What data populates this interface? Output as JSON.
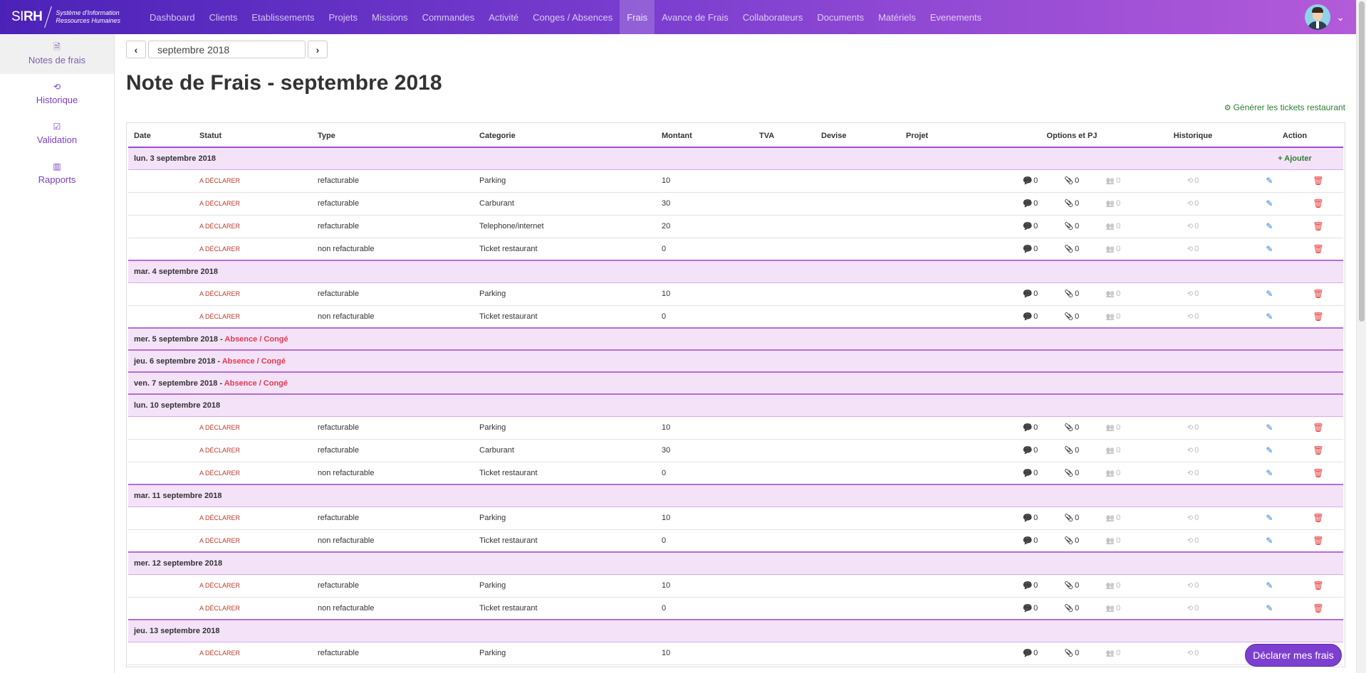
{
  "brand": {
    "mark_bold": "SI",
    "mark_rh": "RH",
    "line1": "Système d'Information",
    "line2": "Ressources Humaines"
  },
  "nav": [
    "Dashboard",
    "Clients",
    "Etablissements",
    "Projets",
    "Missions",
    "Commandes",
    "Activité",
    "Conges / Absences",
    "Frais",
    "Avance de Frais",
    "Collaborateurs",
    "Documents",
    "Matériels",
    "Evenements"
  ],
  "nav_active": "Frais",
  "sidebar": [
    {
      "label": "Notes de frais",
      "icon": "document-icon",
      "glyph": "🗎",
      "active": true
    },
    {
      "label": "Historique",
      "icon": "history-icon",
      "glyph": "⟲",
      "active": false
    },
    {
      "label": "Validation",
      "icon": "check-square-icon",
      "glyph": "☑",
      "active": false
    },
    {
      "label": "Rapports",
      "icon": "bar-chart-icon",
      "glyph": "▥",
      "active": false
    }
  ],
  "month": {
    "value": "septembre 2018",
    "prev": "‹",
    "next": "›"
  },
  "title": "Note de Frais - septembre 2018",
  "generate_label": "Générer les tickets restaurant",
  "add_label": "Ajouter",
  "columns": [
    "Date",
    "Statut",
    "Type",
    "Categorie",
    "Montant",
    "TVA",
    "Devise",
    "Projet",
    "Options et PJ",
    "Historique",
    "Action"
  ],
  "status_label": "A DÉCLARER",
  "absence_label": "Absence / Congé",
  "counts": {
    "comments": "0",
    "attachments": "0",
    "participants": "0",
    "history": "0"
  },
  "days": [
    {
      "label": "lun. 3 septembre 2018",
      "absence": false,
      "add": true,
      "entries": [
        {
          "type": "refacturable",
          "category": "Parking",
          "amount": "10"
        },
        {
          "type": "refacturable",
          "category": "Carburant",
          "amount": "30"
        },
        {
          "type": "refacturable",
          "category": "Telephone/internet",
          "amount": "20"
        },
        {
          "type": "non refacturable",
          "category": "Ticket restaurant",
          "amount": "0"
        }
      ]
    },
    {
      "label": "mar. 4 septembre 2018",
      "absence": false,
      "entries": [
        {
          "type": "refacturable",
          "category": "Parking",
          "amount": "10"
        },
        {
          "type": "non refacturable",
          "category": "Ticket restaurant",
          "amount": "0"
        }
      ]
    },
    {
      "label": "mer. 5 septembre 2018",
      "absence": true,
      "entries": []
    },
    {
      "label": "jeu. 6 septembre 2018",
      "absence": true,
      "entries": []
    },
    {
      "label": "ven. 7 septembre 2018",
      "absence": true,
      "entries": []
    },
    {
      "label": "lun. 10 septembre 2018",
      "absence": false,
      "entries": [
        {
          "type": "refacturable",
          "category": "Parking",
          "amount": "10"
        },
        {
          "type": "refacturable",
          "category": "Carburant",
          "amount": "30"
        },
        {
          "type": "non refacturable",
          "category": "Ticket restaurant",
          "amount": "0"
        }
      ]
    },
    {
      "label": "mar. 11 septembre 2018",
      "absence": false,
      "entries": [
        {
          "type": "refacturable",
          "category": "Parking",
          "amount": "10"
        },
        {
          "type": "non refacturable",
          "category": "Ticket restaurant",
          "amount": "0"
        }
      ]
    },
    {
      "label": "mer. 12 septembre 2018",
      "absence": false,
      "entries": [
        {
          "type": "refacturable",
          "category": "Parking",
          "amount": "10"
        },
        {
          "type": "non refacturable",
          "category": "Ticket restaurant",
          "amount": "0"
        }
      ]
    },
    {
      "label": "jeu. 13 septembre 2018",
      "absence": false,
      "entries": [
        {
          "type": "refacturable",
          "category": "Parking",
          "amount": "10"
        }
      ]
    }
  ],
  "declare_button": "Déclarer mes frais",
  "colors": {
    "nav_start": "#4b22b8",
    "nav_end": "#b35bd9",
    "accent": "#7d3fd0",
    "status": "#c0392b",
    "absence": "#e53950",
    "day_bg": "#f4e3f8",
    "link_green": "#2e7d32"
  }
}
